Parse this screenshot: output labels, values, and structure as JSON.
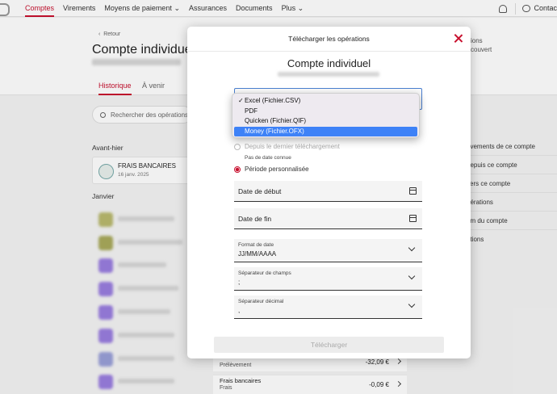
{
  "nav": {
    "items": [
      "Comptes",
      "Virements",
      "Moyens de paiement",
      "Assurances",
      "Documents",
      "Plus"
    ],
    "contact": "Contac"
  },
  "page": {
    "back": "Retour",
    "account_title": "Compte individuel",
    "tabs": [
      "Historique",
      "À venir"
    ],
    "search_placeholder": "Rechercher des opérations",
    "section1": "Avant-hier",
    "frais": {
      "title": "FRAIS BANCAIRES",
      "date": "16 janv. 2025"
    },
    "section2": "Janvier"
  },
  "right_panel": {
    "top1": "ions",
    "top2": "couvert",
    "items": [
      "uvements de ce compte",
      "depuis ce compte",
      "vers ce compte",
      "pérations",
      "um du compte",
      "ations"
    ]
  },
  "bottom_rows": [
    {
      "title": "",
      "sub": "Prélèvement",
      "amount": "-32,09 €"
    },
    {
      "title": "Frais bancaires",
      "sub": "Frais",
      "amount": "-0,09 €"
    }
  ],
  "modal": {
    "header": "Télécharger les opérations",
    "title": "Compte individuel",
    "radio_last": "Depuis le dernier téléchargement",
    "no_date": "Pas de date connue",
    "radio_custom": "Période personnalisée",
    "start_date": "Date de début",
    "end_date": "Date de fin",
    "date_format": {
      "label": "Format de date",
      "value": "JJ/MM/AAAA"
    },
    "field_sep": {
      "label": "Séparateur de champs",
      "value": ";"
    },
    "decimal_sep": {
      "label": "Séparateur décimal",
      "value": ","
    },
    "download": "Télécharger"
  },
  "dropdown": {
    "options": [
      "Excel (Fichier.CSV)",
      "PDF",
      "Quicken (Fichier.QIF)",
      "Money (Fichier.OFX)"
    ],
    "checked": "✓",
    "checked_index": 0,
    "highlighted_index": 3
  },
  "colors": {
    "accent": "#c8102e",
    "highlight": "#3e82f7"
  }
}
